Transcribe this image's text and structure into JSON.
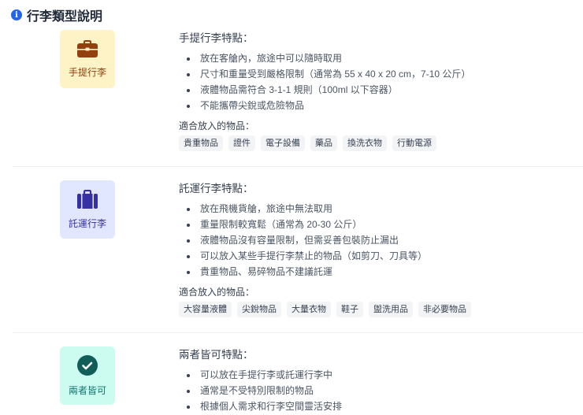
{
  "header": {
    "title": "行李類型說明",
    "icon": "info-icon"
  },
  "sections": [
    {
      "label": "手提行李",
      "icon": "briefcase-icon",
      "bg": "#fef3c7",
      "fg": "#92400e",
      "title": "手提行李特點：",
      "bullets": [
        "放在客艙內，旅途中可以隨時取用",
        "尺寸和重量受到嚴格限制（通常為 55 x 40 x 20 cm，7-10 公斤）",
        "液體物品需符合 3-1-1 規則（100ml 以下容器）",
        "不能攜帶尖銳或危險物品"
      ],
      "suitable_label": "適合放入的物品：",
      "tags": [
        "貴重物品",
        "證件",
        "電子設備",
        "藥品",
        "換洗衣物",
        "行動電源"
      ]
    },
    {
      "label": "託運行李",
      "icon": "suitcase-icon",
      "bg": "#e0e7ff",
      "fg": "#3730a3",
      "title": "託運行李特點：",
      "bullets": [
        "放在飛機貨艙，旅途中無法取用",
        "重量限制較寬鬆（通常為 20-30 公斤）",
        "液體物品沒有容量限制，但需妥善包裝防止漏出",
        "可以放入某些手提行李禁止的物品（如剪刀、刀具等）",
        "貴重物品、易碎物品不建議託運"
      ],
      "suitable_label": "適合放入的物品：",
      "tags": [
        "大容量液體",
        "尖銳物品",
        "大量衣物",
        "鞋子",
        "盥洗用品",
        "非必要物品"
      ]
    },
    {
      "label": "兩者皆可",
      "icon": "check-circle-icon",
      "bg": "#ccfbef",
      "fg": "#115e59",
      "title": "兩者皆可特點：",
      "bullets": [
        "可以放在手提行李或託運行李中",
        "通常是不受特別限制的物品",
        "根據個人需求和行李空間靈活安排"
      ]
    }
  ]
}
